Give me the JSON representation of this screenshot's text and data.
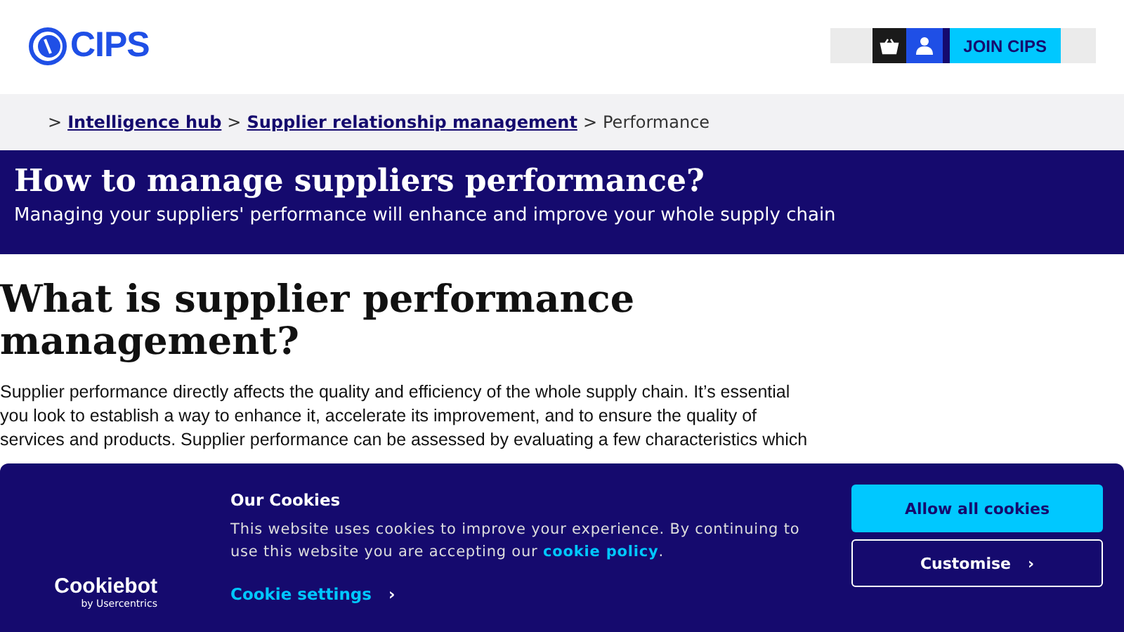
{
  "header": {
    "logo_text": "CIPS",
    "join_button": "JOIN CIPS"
  },
  "breadcrumb": {
    "separator": ">",
    "items": [
      {
        "label": "Intelligence hub",
        "kind": "link"
      },
      {
        "label": "Supplier relationship management",
        "kind": "link"
      },
      {
        "label": "Performance",
        "kind": "current"
      }
    ]
  },
  "hero": {
    "title": "How to manage suppliers performance?",
    "subtitle": "Managing your suppliers' performance will enhance and improve your whole supply chain"
  },
  "article": {
    "heading": "What is supplier performance management?",
    "paragraph": "Supplier performance directly affects the quality and efficiency of the whole supply chain. It’s essential you look to establish a way to enhance it, accelerate its improvement, and to ensure the quality of services and products. Supplier performance can be assessed by evaluating a few characteristics which"
  },
  "cookie_banner": {
    "brand": "Cookiebot",
    "brand_sub": "by Usercentrics",
    "title": "Our Cookies",
    "text_before": "This website uses cookies to improve your experience. By continuing to use this website you are accepting our",
    "policy_link": "cookie policy",
    "text_after": ".",
    "settings_link": "Cookie settings",
    "chevron": "›",
    "allow_button": "Allow all cookies",
    "customise_button": "Customise"
  }
}
